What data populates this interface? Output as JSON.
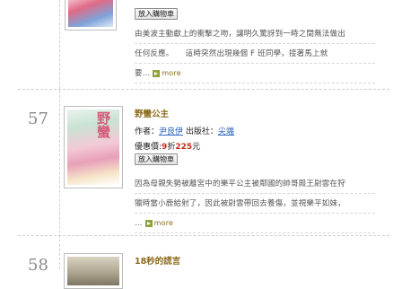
{
  "books": [
    {
      "cart_label": "放入購物車",
      "desc_lines": [
        "由美波主動獻上的衝擊之吻，讓明久驚訝到一時之間無法做出",
        "任何反應。　　這時突然出現幾個 F 班同學，接著馬上就",
        "要…"
      ],
      "more_label": "more"
    },
    {
      "rank": "57",
      "title": "野蠻公主",
      "author_label": "作者：",
      "author": "尹良伊",
      "publisher_label": "出版社：",
      "publisher": "尖端",
      "price_label": "優惠價:",
      "discount": "9",
      "discount_unit": "折",
      "price": "225",
      "price_unit": "元",
      "cart_label": "放入購物車",
      "desc_lines": [
        "因為母親失勢被離宮中的樂平公主被鄰國的帥哥殿王尉雲在狩",
        "獵時當小鹿給射了，因此被尉雲帶回去養傷，並視樂平如妹，",
        "…"
      ],
      "more_label": "more"
    },
    {
      "rank": "58",
      "title": "18秒的謊言"
    }
  ]
}
